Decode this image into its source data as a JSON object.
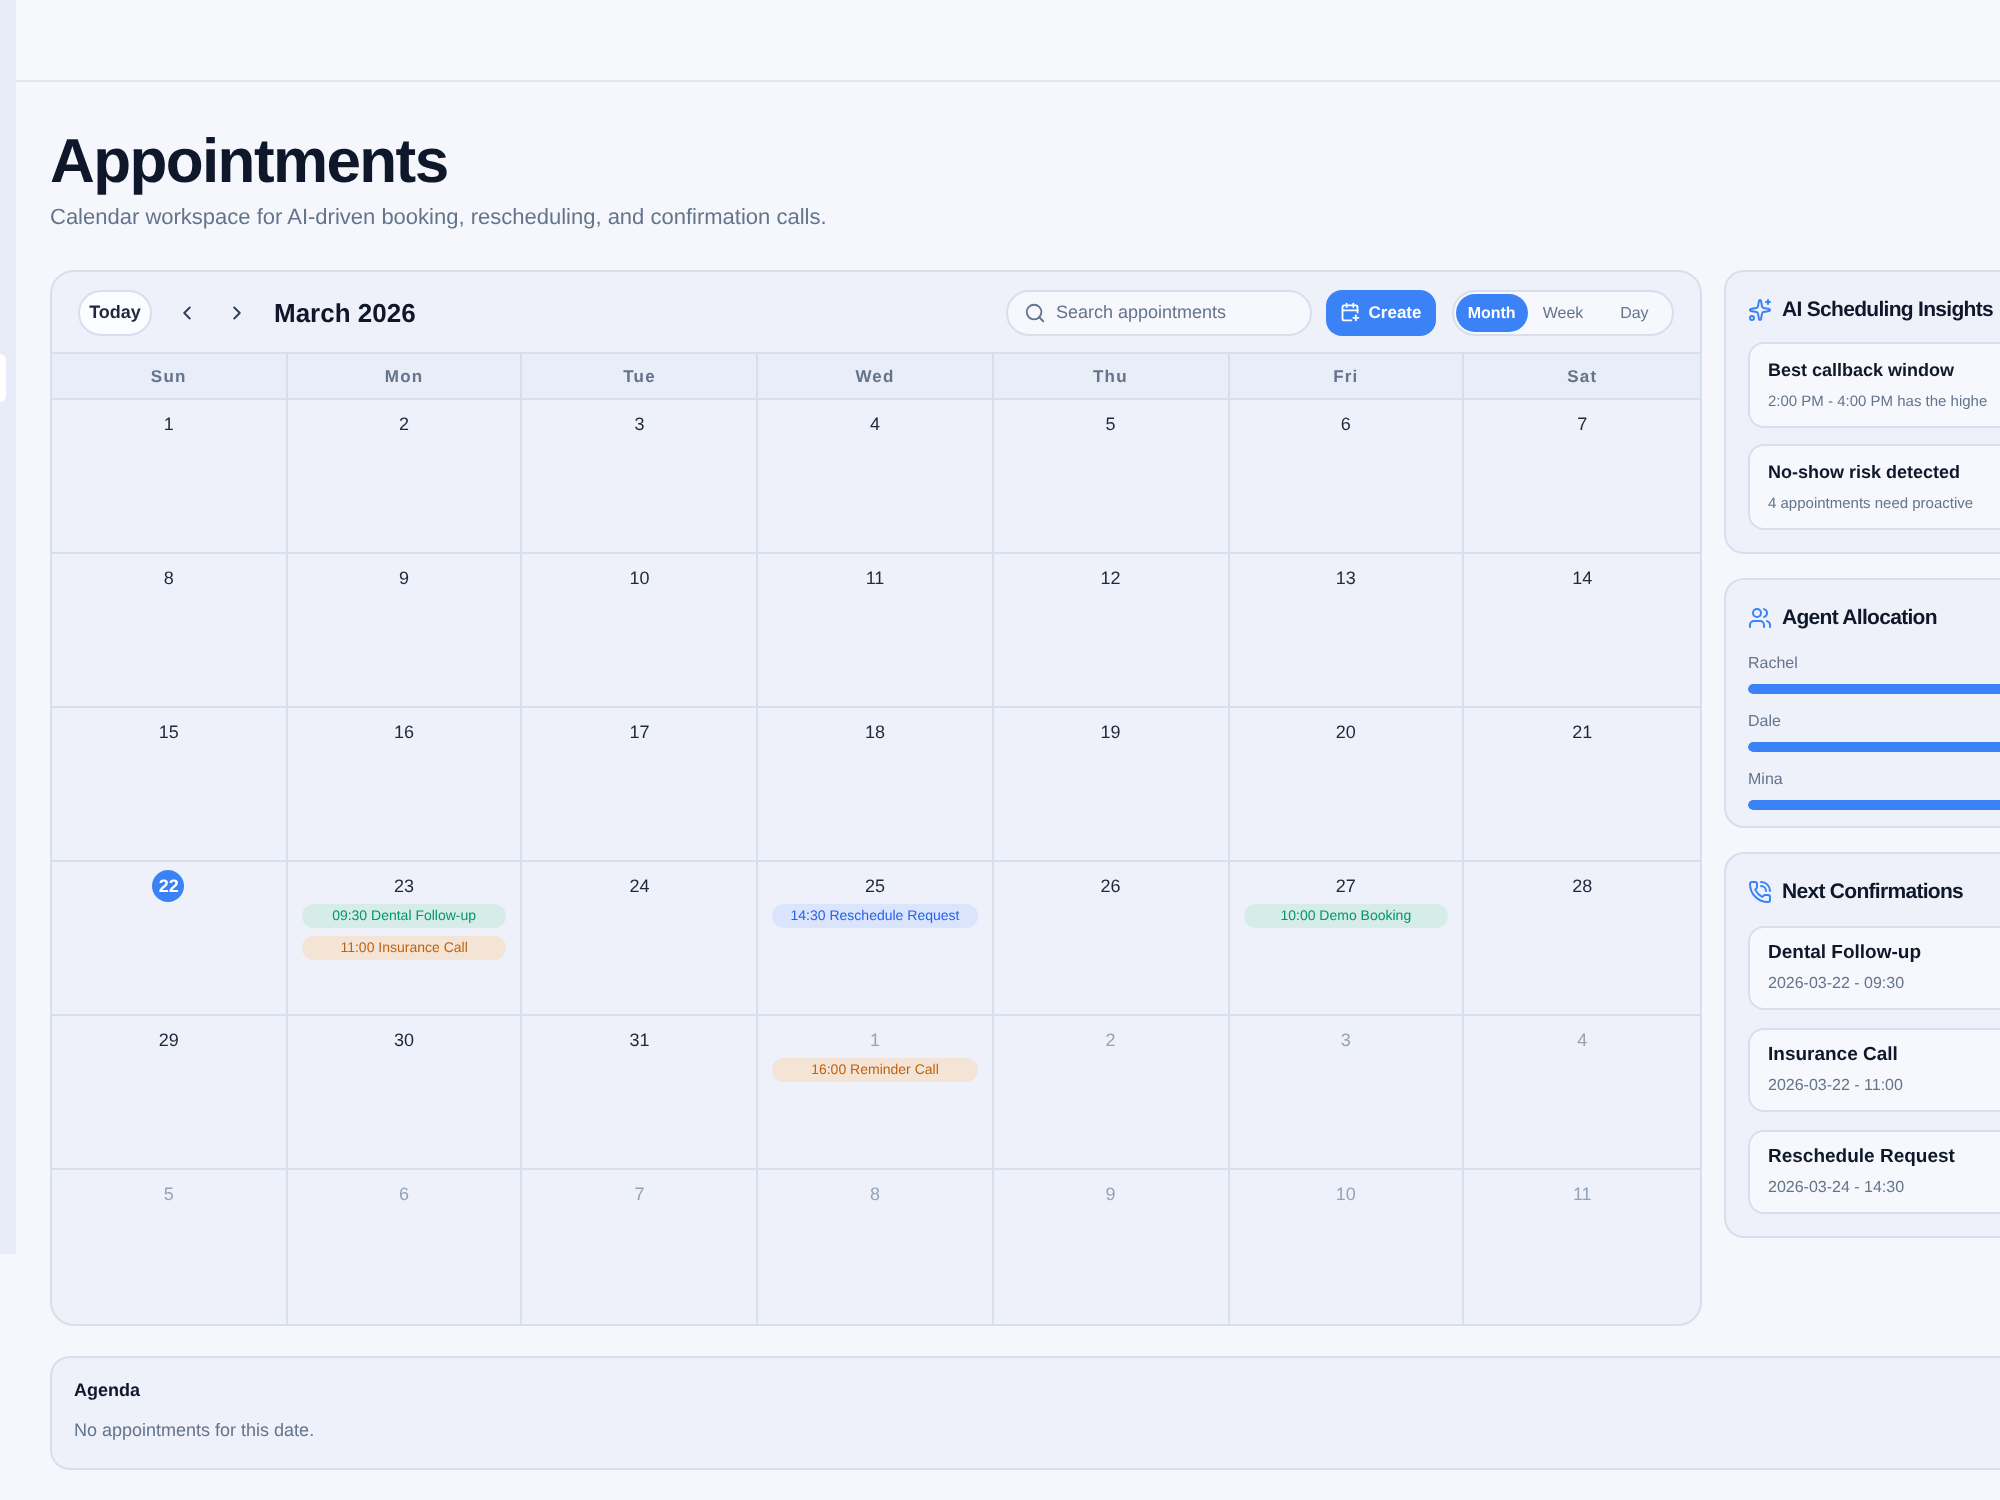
{
  "page": {
    "title": "Appointments",
    "subtitle": "Calendar workspace for AI-driven booking, rescheduling, and confirmation calls."
  },
  "calendar": {
    "today_button": "Today",
    "month_label": "March 2026",
    "search": {
      "placeholder": "Search appointments"
    },
    "create_button": "Create",
    "views": [
      {
        "label": "Month",
        "selected": true
      },
      {
        "label": "Week",
        "selected": false
      },
      {
        "label": "Day",
        "selected": false
      }
    ],
    "weekdays": [
      "Sun",
      "Mon",
      "Tue",
      "Wed",
      "Thu",
      "Fri",
      "Sat"
    ],
    "weeks": [
      {
        "days": [
          {
            "day": "1",
            "in_month": true,
            "selected": false
          },
          {
            "day": "2",
            "in_month": true,
            "selected": false
          },
          {
            "day": "3",
            "in_month": true,
            "selected": false
          },
          {
            "day": "4",
            "in_month": true,
            "selected": false
          },
          {
            "day": "5",
            "in_month": true,
            "selected": false
          },
          {
            "day": "6",
            "in_month": true,
            "selected": false
          },
          {
            "day": "7",
            "in_month": true,
            "selected": false
          }
        ]
      },
      {
        "days": [
          {
            "day": "8",
            "in_month": true,
            "selected": false
          },
          {
            "day": "9",
            "in_month": true,
            "selected": false
          },
          {
            "day": "10",
            "in_month": true,
            "selected": false
          },
          {
            "day": "11",
            "in_month": true,
            "selected": false
          },
          {
            "day": "12",
            "in_month": true,
            "selected": false
          },
          {
            "day": "13",
            "in_month": true,
            "selected": false
          },
          {
            "day": "14",
            "in_month": true,
            "selected": false
          }
        ]
      },
      {
        "days": [
          {
            "day": "15",
            "in_month": true,
            "selected": false
          },
          {
            "day": "16",
            "in_month": true,
            "selected": false
          },
          {
            "day": "17",
            "in_month": true,
            "selected": false
          },
          {
            "day": "18",
            "in_month": true,
            "selected": false
          },
          {
            "day": "19",
            "in_month": true,
            "selected": false
          },
          {
            "day": "20",
            "in_month": true,
            "selected": false
          },
          {
            "day": "21",
            "in_month": true,
            "selected": false
          }
        ]
      },
      {
        "days": [
          {
            "day": "22",
            "in_month": true,
            "selected": true
          },
          {
            "day": "23",
            "in_month": true,
            "selected": false,
            "events": [
              {
                "label": "09:30 Dental Follow-up",
                "color": "#059669"
              },
              {
                "label": "11:00 Insurance Call",
                "color": "#c0620e"
              }
            ]
          },
          {
            "day": "24",
            "in_month": true,
            "selected": false
          },
          {
            "day": "25",
            "in_month": true,
            "selected": false,
            "events": [
              {
                "label": "14:30 Reschedule Request",
                "color": "#2563eb"
              }
            ]
          },
          {
            "day": "26",
            "in_month": true,
            "selected": false
          },
          {
            "day": "27",
            "in_month": true,
            "selected": false,
            "events": [
              {
                "label": "10:00 Demo Booking",
                "color": "#059669"
              }
            ]
          },
          {
            "day": "28",
            "in_month": true,
            "selected": false
          }
        ]
      },
      {
        "days": [
          {
            "day": "29",
            "in_month": true,
            "selected": false
          },
          {
            "day": "30",
            "in_month": true,
            "selected": false
          },
          {
            "day": "31",
            "in_month": true,
            "selected": false
          },
          {
            "day": "1",
            "in_month": false,
            "selected": false,
            "events": [
              {
                "label": "16:00 Reminder Call",
                "color": "#c0620e"
              }
            ]
          },
          {
            "day": "2",
            "in_month": false,
            "selected": false
          },
          {
            "day": "3",
            "in_month": false,
            "selected": false
          },
          {
            "day": "4",
            "in_month": false,
            "selected": false
          }
        ]
      },
      {
        "days": [
          {
            "day": "5",
            "in_month": false,
            "selected": false
          },
          {
            "day": "6",
            "in_month": false,
            "selected": false
          },
          {
            "day": "7",
            "in_month": false,
            "selected": false
          },
          {
            "day": "8",
            "in_month": false,
            "selected": false
          },
          {
            "day": "9",
            "in_month": false,
            "selected": false
          },
          {
            "day": "10",
            "in_month": false,
            "selected": false
          },
          {
            "day": "11",
            "in_month": false,
            "selected": false
          }
        ]
      }
    ]
  },
  "insights": {
    "title": "AI Scheduling Insights",
    "items": [
      {
        "title": "Best callback window",
        "text": "2:00 PM - 4:00 PM has the highe"
      },
      {
        "title": "No-show risk detected",
        "text": "4 appointments need proactive"
      }
    ]
  },
  "agents": {
    "title": "Agent Allocation",
    "items": [
      {
        "name": "Rachel",
        "level": 1
      },
      {
        "name": "Dale",
        "level": 1
      },
      {
        "name": "Mina",
        "level": 1
      }
    ]
  },
  "confirmations": {
    "title": "Next Confirmations",
    "items": [
      {
        "title": "Dental Follow-up",
        "when": "2026-03-22 - 09:30"
      },
      {
        "title": "Insurance Call",
        "when": "2026-03-22 - 11:00"
      },
      {
        "title": "Reschedule Request",
        "when": "2026-03-24 - 14:30"
      }
    ]
  },
  "agenda": {
    "title": "Agenda",
    "empty_text": "No appointments for this date."
  }
}
